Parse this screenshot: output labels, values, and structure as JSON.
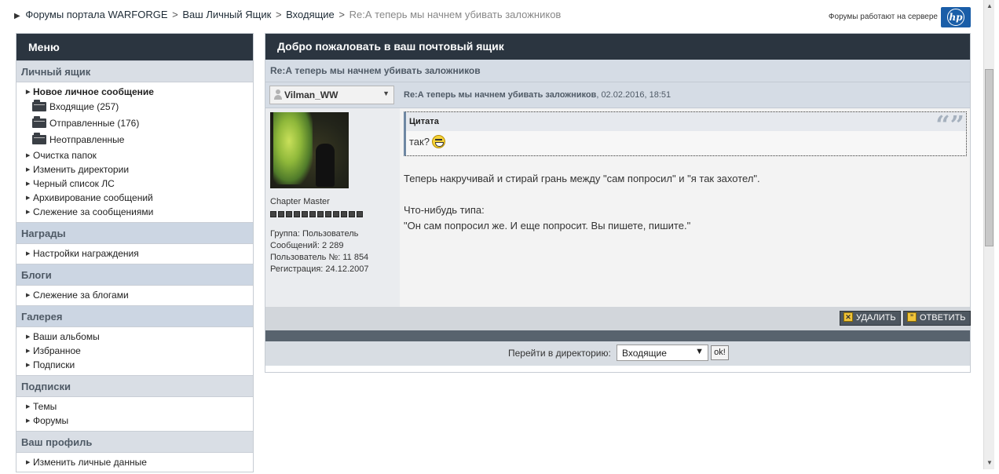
{
  "breadcrumb": {
    "items": [
      "Форумы портала WARFORGE",
      "Ваш Личный Ящик",
      "Входящие"
    ],
    "current": "Re:А теперь мы начнем убивать заложников",
    "separator": ">"
  },
  "server_note": "Форумы работают на сервере",
  "logo_text": "hp",
  "sidebar": {
    "title": "Меню",
    "sections": [
      {
        "title": "Личный ящик",
        "items": [
          {
            "label": "Новое личное сообщение",
            "bold": true
          },
          {
            "label": "Входящие (257)",
            "folder": true
          },
          {
            "label": "Отправленные (176)",
            "folder": true
          },
          {
            "label": "Неотправленные",
            "folder": true
          },
          {
            "label": "Очистка папок"
          },
          {
            "label": "Изменить директории"
          },
          {
            "label": "Черный список ЛС"
          },
          {
            "label": "Архивирование сообщений"
          },
          {
            "label": "Слежение за сообщениями"
          }
        ]
      },
      {
        "title": "Награды",
        "items": [
          {
            "label": "Настройки награждения"
          }
        ]
      },
      {
        "title": "Блоги",
        "items": [
          {
            "label": "Слежение за блогами"
          }
        ]
      },
      {
        "title": "Галерея",
        "items": [
          {
            "label": "Ваши альбомы"
          },
          {
            "label": "Избранное"
          },
          {
            "label": "Подписки"
          }
        ]
      },
      {
        "title": "Подписки",
        "items": [
          {
            "label": "Темы"
          },
          {
            "label": "Форумы"
          }
        ]
      },
      {
        "title": "Ваш профиль",
        "items": [
          {
            "label": "Изменить личные данные"
          }
        ]
      }
    ]
  },
  "main": {
    "title": "Добро пожаловать в ваш почтовый ящик",
    "subject": "Re:А теперь мы начнем убивать заложников",
    "author_name": "Vilman_WW",
    "post_subject": "Re:А теперь мы начнем убивать заложников",
    "post_date": ", 02.02.2016, 18:51",
    "author_title": "Chapter Master",
    "rank_pips": 12,
    "author_info": {
      "group": "Группа: Пользователь",
      "posts": "Сообщений: 2 289",
      "user_no": "Пользователь №: 11 854",
      "registered": "Регистрация: 24.12.2007"
    },
    "quote_label": "Цитата",
    "quote_text": "так?",
    "message_lines": [
      "Теперь накручивай и стирай грань между \"сам попросил\" и \"я так захотел\".",
      "",
      "Что-нибудь типа:",
      "\"Он сам попросил же. И еще попросит. Вы пишете, пишите.\""
    ],
    "delete_label": "УДАЛИТЬ",
    "reply_label": "ОТВЕТИТЬ",
    "jump_label": "Перейти в директорию:",
    "jump_selected": "Входящие",
    "ok_label": "ok!"
  },
  "colors": {
    "header_dark": "#2b3540",
    "section_bg": "#d9dee5",
    "accent_blue": "#1a5ea8"
  }
}
